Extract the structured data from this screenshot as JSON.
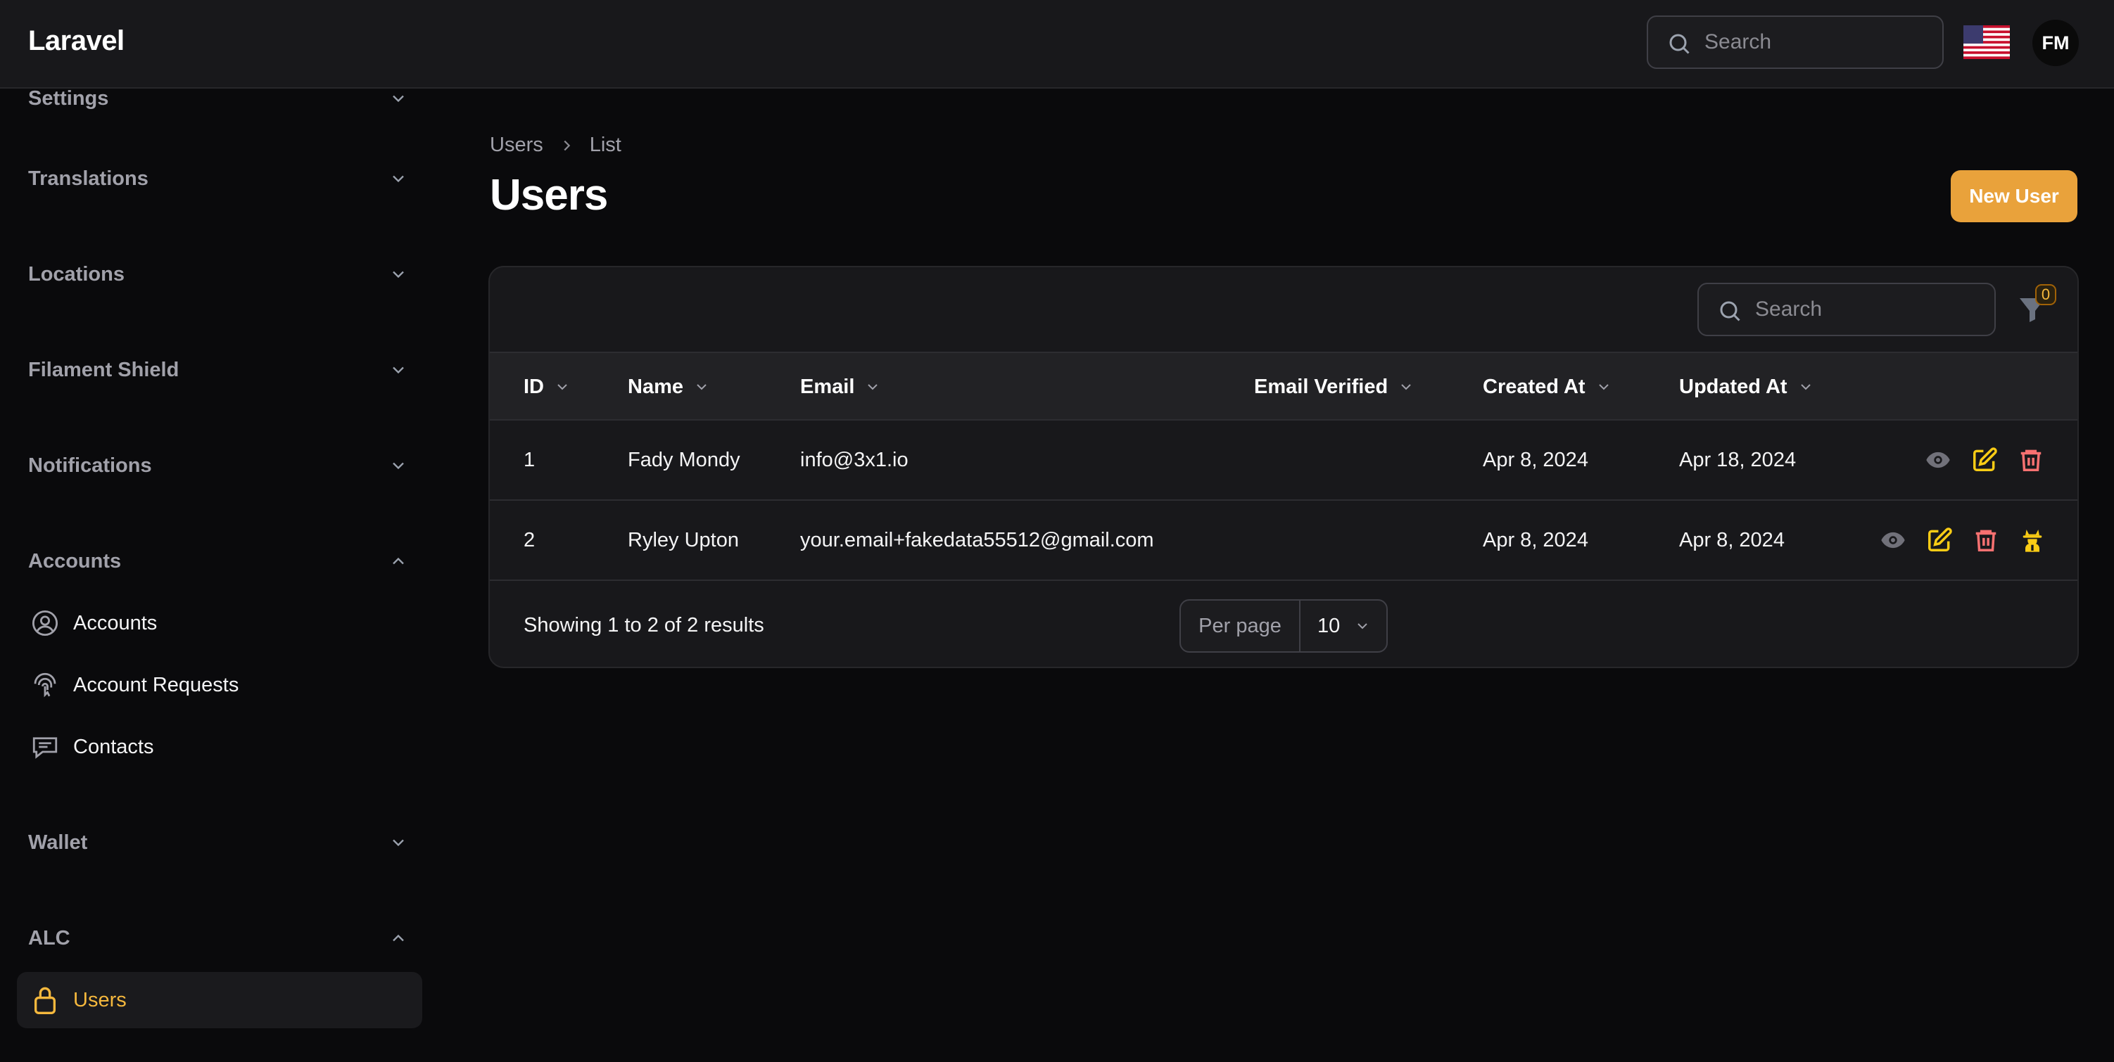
{
  "app": {
    "brand": "Laravel"
  },
  "topbar": {
    "search_placeholder": "Search",
    "avatar_initials": "FM"
  },
  "sidebar": {
    "groups": [
      {
        "label": "Settings"
      },
      {
        "label": "Translations"
      },
      {
        "label": "Locations"
      },
      {
        "label": "Filament Shield"
      },
      {
        "label": "Notifications"
      },
      {
        "label": "Accounts"
      },
      {
        "label": "Wallet"
      },
      {
        "label": "ALC"
      }
    ],
    "accounts_items": [
      {
        "label": "Accounts",
        "icon": "user-circle-icon"
      },
      {
        "label": "Account Requests",
        "icon": "finger-print-icon"
      },
      {
        "label": "Contacts",
        "icon": "chat-bubble-icon"
      }
    ],
    "alc_items": [
      {
        "label": "Users",
        "icon": "lock-icon",
        "active": true
      }
    ]
  },
  "breadcrumb": {
    "items": [
      "Users",
      "List"
    ]
  },
  "page": {
    "title": "Users",
    "new_button": "New User"
  },
  "table": {
    "search_placeholder": "Search",
    "filter_count": "0",
    "columns": [
      "ID",
      "Name",
      "Email",
      "Email Verified",
      "Created At",
      "Updated At"
    ],
    "rows": [
      {
        "id": "1",
        "name": "Fady Mondy",
        "email": "info@3x1.io",
        "email_verified": "",
        "created_at": "Apr 8, 2024",
        "updated_at": "Apr 18, 2024",
        "actions": [
          "view-icon",
          "edit-icon",
          "delete-icon"
        ]
      },
      {
        "id": "2",
        "name": "Ryley Upton",
        "email": "your.email+fakedata55512@gmail.com",
        "email_verified": "",
        "created_at": "Apr 8, 2024",
        "updated_at": "Apr 8, 2024",
        "actions": [
          "view-icon",
          "edit-icon",
          "delete-icon",
          "impersonate-icon"
        ]
      }
    ],
    "footer": {
      "showing": "Showing 1 to 2 of 2 results",
      "per_page_label": "Per page",
      "per_page_value": "10"
    }
  },
  "colors": {
    "accent": "#e9a23b",
    "danger": "#f87171",
    "edit": "#facc15",
    "muted": "#71717a"
  }
}
